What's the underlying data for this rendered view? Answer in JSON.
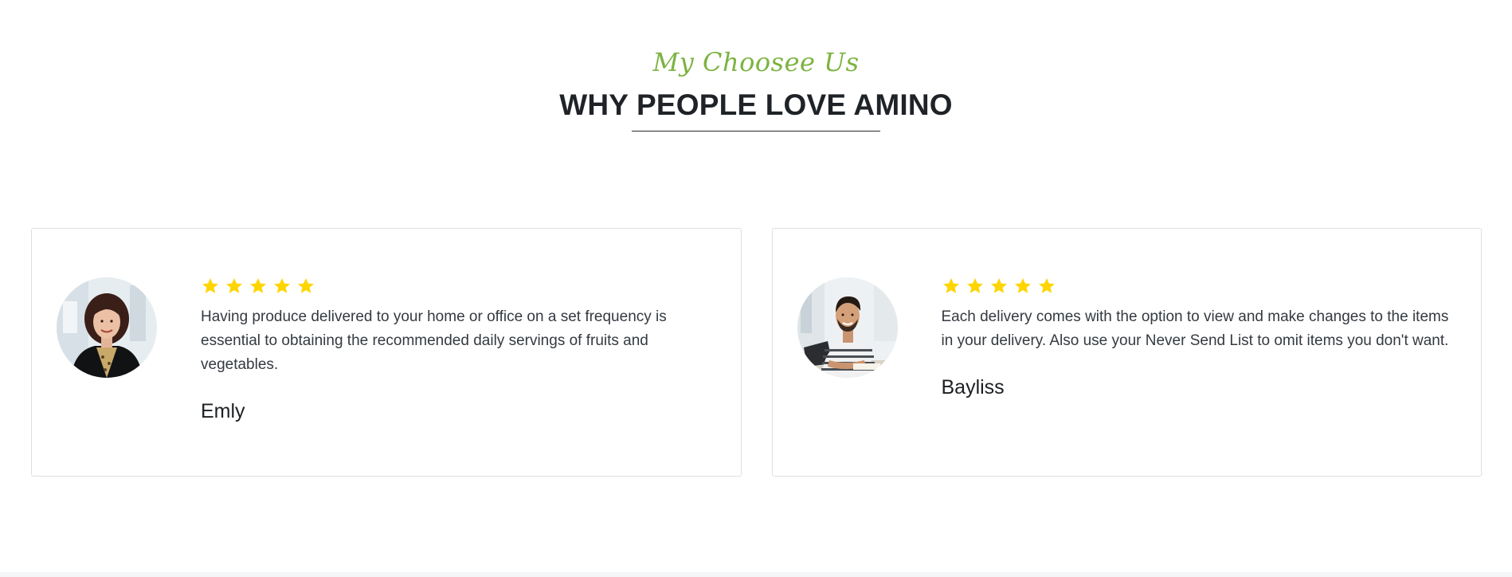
{
  "section": {
    "subtitle": "My Choosee Us",
    "title": "WHY PEOPLE LOVE AMINO"
  },
  "colors": {
    "accent_green": "#7cb342",
    "star_yellow": "#ffd500",
    "card_border": "#dcdfe3"
  },
  "testimonials": [
    {
      "avatar_icon": "woman-portrait",
      "rating": 5,
      "quote": "Having produce delivered to your home or office on a set frequency is essential to obtaining the recommended daily servings of fruits and vegetables.",
      "name": "Emly"
    },
    {
      "avatar_icon": "man-portrait",
      "rating": 5,
      "quote": "Each delivery comes with the option to view and make changes to the items in your delivery. Also use your Never Send List to omit items you don't want.",
      "name": "Bayliss"
    }
  ]
}
